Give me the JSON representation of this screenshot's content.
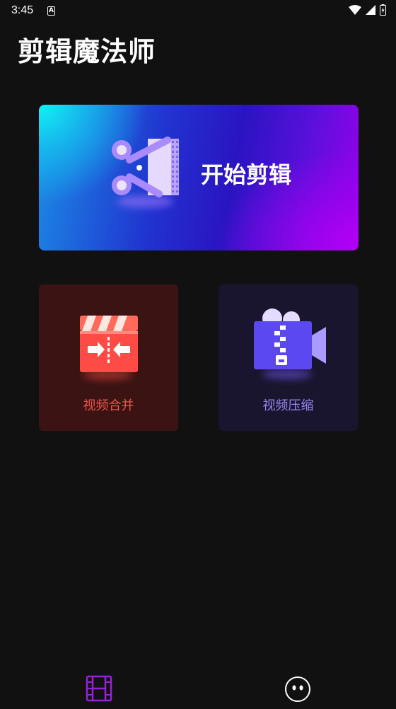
{
  "status_bar": {
    "time": "3:45",
    "notification_letter": "A"
  },
  "app": {
    "title": "剪辑魔法师"
  },
  "hero": {
    "label": "开始剪辑",
    "icon": "scissors-film-icon"
  },
  "cards": [
    {
      "label": "视频合并",
      "icon": "clapperboard-merge-icon",
      "color": "#e8564c"
    },
    {
      "label": "视频压缩",
      "icon": "video-zip-icon",
      "color": "#9a86f2"
    }
  ],
  "nav": {
    "items": [
      {
        "icon": "film-strip-icon",
        "active": true,
        "color": "#9b1fd8"
      },
      {
        "icon": "face-icon",
        "active": false
      }
    ]
  }
}
